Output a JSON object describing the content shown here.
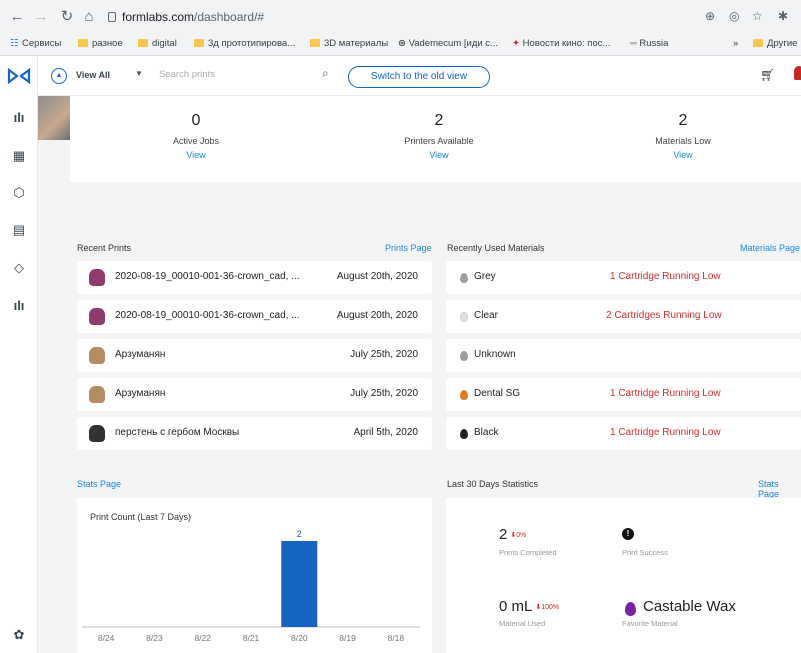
{
  "browser": {
    "url_domain": "formlabs.com",
    "url_path": "/dashboard/#",
    "bookmarks": [
      "Сервисы",
      "разное",
      "digital",
      "3д прототипирова...",
      "3D материалы",
      "Vademecum [иди с...",
      "Новости кино: пос...",
      "Russia",
      "»",
      "Другие"
    ]
  },
  "topbar": {
    "view_all": "View All",
    "search_placeholder": "Search prints",
    "switch_button": "Switch to the old view"
  },
  "summary": [
    {
      "value": "0",
      "label": "Active Jobs",
      "link": "View"
    },
    {
      "value": "2",
      "label": "Printers Available",
      "link": "View"
    },
    {
      "value": "2",
      "label": "Materials Low",
      "link": "View"
    }
  ],
  "recent_prints": {
    "title": "Recent Prints",
    "link": "Prints Page",
    "rows": [
      {
        "name": "2020-08-19_00010-001-36-crown_cad, ...",
        "date": "August 20th, 2020",
        "icon_color": "#8e3a6b"
      },
      {
        "name": "2020-08-19_00010-001-36-crown_cad, ...",
        "date": "August 20th, 2020",
        "icon_color": "#8e3a6b"
      },
      {
        "name": "Арзуманян",
        "date": "July 25th, 2020",
        "icon_color": "#b58b62"
      },
      {
        "name": "Арзуманян",
        "date": "July 25th, 2020",
        "icon_color": "#b58b62"
      },
      {
        "name": "перстень с гербом Москвы",
        "date": "April 5th, 2020",
        "icon_color": "#333333"
      }
    ]
  },
  "materials": {
    "title": "Recently Used Materials",
    "link": "Materials Page",
    "rows": [
      {
        "name": "Grey",
        "status": "1 Cartridge Running Low",
        "color": "#9e9e9e"
      },
      {
        "name": "Clear",
        "status": "2 Cartridges Running Low",
        "color": "#e0e0e0"
      },
      {
        "name": "Unknown",
        "status": "",
        "color": "#9e9e9e"
      },
      {
        "name": "Dental SG",
        "status": "1 Cartridge Running Low",
        "color": "#e07b1f"
      },
      {
        "name": "Black",
        "status": "1 Cartridge Running Low",
        "color": "#222222"
      }
    ]
  },
  "stats": {
    "stats_link": "Stats Page",
    "last30_title": "Last 30 Days Statistics",
    "last30_link": "Stats Page",
    "prints_completed": {
      "value": "2",
      "delta": "0%",
      "label": "Prints Completed"
    },
    "print_success": {
      "label": "Print Success"
    },
    "material_used": {
      "value": "0 mL",
      "delta": "100%",
      "label": "Material Used"
    },
    "favorite_material": {
      "value": "Castable Wax",
      "label": "Favorite Material",
      "color": "#7b1fa2"
    }
  },
  "chart_data": {
    "type": "bar",
    "title": "Print Count (Last 7 Days)",
    "categories": [
      "8/24",
      "8/23",
      "8/22",
      "8/21",
      "8/20",
      "8/19",
      "8/18"
    ],
    "values": [
      0,
      0,
      0,
      0,
      2,
      0,
      0
    ],
    "data_labels": [
      "",
      "",
      "",
      "",
      "2",
      "",
      ""
    ],
    "bar_color": "#1565c0",
    "grid": false
  }
}
